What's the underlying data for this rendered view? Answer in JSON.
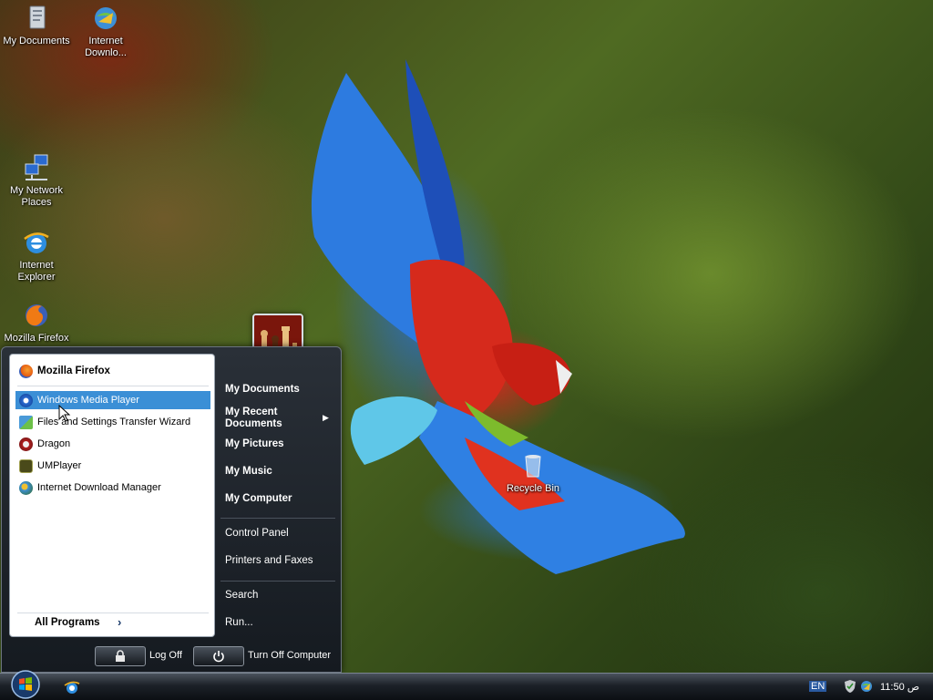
{
  "desktop": {
    "icons": [
      {
        "label": "My Documents"
      },
      {
        "label": "Internet Downlo..."
      },
      {
        "label": "My Network Places"
      },
      {
        "label": "Internet Explorer"
      },
      {
        "label": "Mozilla Firefox"
      },
      {
        "label": "Recycle Bin"
      }
    ]
  },
  "start_menu": {
    "pinned": [
      {
        "label": "Mozilla Firefox",
        "icon": "firefox-icon"
      }
    ],
    "recent": [
      {
        "label": "Windows Media Player",
        "icon": "media-player-icon",
        "selected": true
      },
      {
        "label": "Files and Settings Transfer Wizard",
        "icon": "transfer-wizard-icon"
      },
      {
        "label": "Dragon",
        "icon": "dragon-icon"
      },
      {
        "label": "UMPlayer",
        "icon": "umplayer-icon"
      },
      {
        "label": "Internet Download Manager",
        "icon": "idm-icon"
      }
    ],
    "all_programs": "All Programs",
    "all_programs_arrow": "›",
    "places": [
      {
        "label": "My Documents"
      },
      {
        "label": "My Recent Documents"
      },
      {
        "label": "My Pictures"
      },
      {
        "label": "My Music"
      },
      {
        "label": "My Computer"
      }
    ],
    "system": [
      {
        "label": "Control Panel"
      },
      {
        "label": "Printers and Faxes"
      }
    ],
    "tools": [
      {
        "label": "Search"
      },
      {
        "label": "Run..."
      }
    ],
    "log_off": "Log Off",
    "turn_off": "Turn Off Computer"
  },
  "taskbar": {
    "language": "EN",
    "clock": "11:50 ص",
    "accent": "#3b8fd6"
  }
}
